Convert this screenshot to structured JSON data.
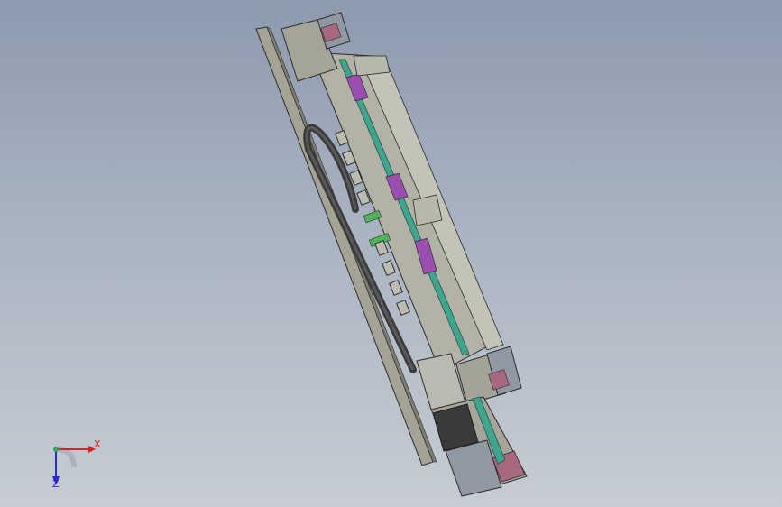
{
  "triad": {
    "x_label": "X",
    "z_label": "Z",
    "x_color": "#e0201c",
    "y_color": "#22b14c",
    "z_color": "#2a2ad8"
  },
  "viewport": {
    "background_top": "#8d9aae",
    "background_bottom": "#c7ccd3"
  },
  "model": {
    "part_color": "#a8a79a",
    "edge_color": "#2b2b2b",
    "rail_color": "#3fa58f",
    "block_color": "#9a4fb0",
    "motor_color": "#8f98a3",
    "chain_color": "#3a3a3a"
  }
}
